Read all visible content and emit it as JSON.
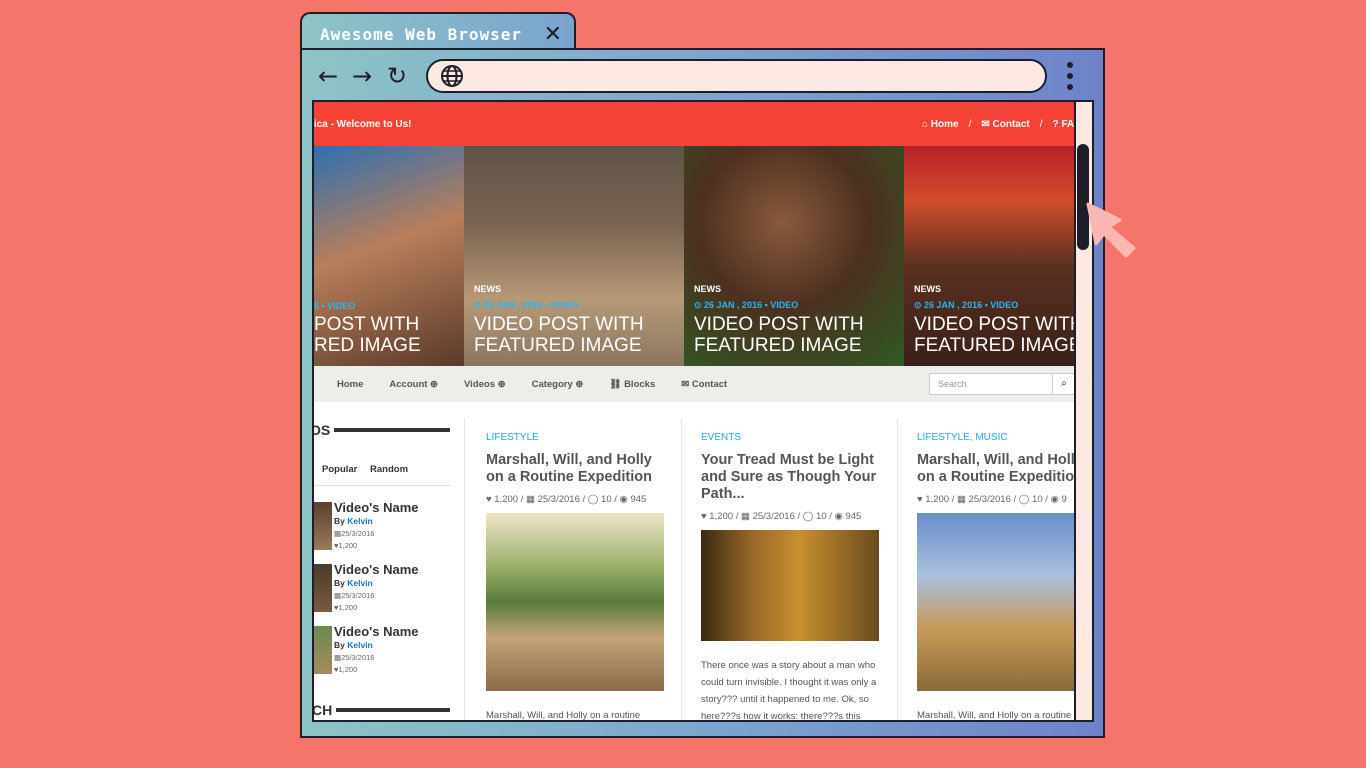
{
  "browser": {
    "tab_title": "Awesome Web Browser",
    "close": "✕",
    "back": "←",
    "forward": "→",
    "reload": "↻"
  },
  "site": {
    "welcome": "rica - Welcome to Us!",
    "top_links": [
      "Home",
      "Contact",
      "FAQ"
    ],
    "sep": "/",
    "slides": [
      {
        "category": "",
        "meta": "6 ▪ VIDEO",
        "title1": "POST WITH",
        "title2": "RED IMAGE"
      },
      {
        "category": "NEWS",
        "meta": "⊙ 26 JAN , 2016 ▪ VIDEO",
        "title1": "VIDEO POST WITH",
        "title2": "FEATURED IMAGE"
      },
      {
        "category": "NEWS",
        "meta": "⊙ 26 JAN , 2016 ▪ VIDEO",
        "title1": "VIDEO POST WITH",
        "title2": "FEATURED IMAGE"
      },
      {
        "category": "NEWS",
        "meta": "⊙ 26 JAN , 2016 ▪ VIDEO",
        "title1": "VIDEO POST WITH",
        "title2": "FEATURED IMAGE"
      }
    ],
    "menu": [
      "Home",
      "Account ⊕",
      "Videos ⊕",
      "Category ⊕",
      "⛓ Blocks",
      "✉ Contact"
    ],
    "search_placeholder": "Search",
    "sidebar": {
      "heading": "OS",
      "tabs": [
        "Popular",
        "Random"
      ],
      "videos": [
        {
          "name": "Video's Name",
          "by": "By ",
          "author": "Kelvin",
          "date": "▦25/3/2016",
          "likes": "♥1,200"
        },
        {
          "name": "Video's Name",
          "by": "By ",
          "author": "Kelvin",
          "date": "▦25/3/2016",
          "likes": "♥1,200"
        },
        {
          "name": "Video's Name",
          "by": "By ",
          "author": "Kelvin",
          "date": "▦25/3/2016",
          "likes": "♥1,200"
        }
      ],
      "heading2": "CH"
    },
    "posts": [
      {
        "category": "LIFESTYLE",
        "title": "Marshall, Will, and Holly on a Routine Expedition",
        "stats": "♥ 1,200 / ▦ 25/3/2016 / ◯ 10 / ◉ 945",
        "excerpt": "Marshall, Will, and Holly on a routine"
      },
      {
        "category": "EVENTS",
        "title": "Your Tread Must be Light and Sure as Though Your Path...",
        "stats": "♥ 1,200 / ▦ 25/3/2016 / ◯ 10 / ◉ 945",
        "excerpt": "There once was a story about a man who could turn invisible. I thought it was only a story??? until it happened to me. Ok, so here???s how it works: there???s this"
      },
      {
        "category": "LIFESTYLE, MUSIC",
        "title": "Marshall, Will, and Holly on a Routine Expedition",
        "stats": "♥ 1,200 / ▦ 25/3/2016 / ◯ 10 / ◉ 9",
        "excerpt": "Marshall, Will, and Holly on a routine"
      }
    ]
  }
}
